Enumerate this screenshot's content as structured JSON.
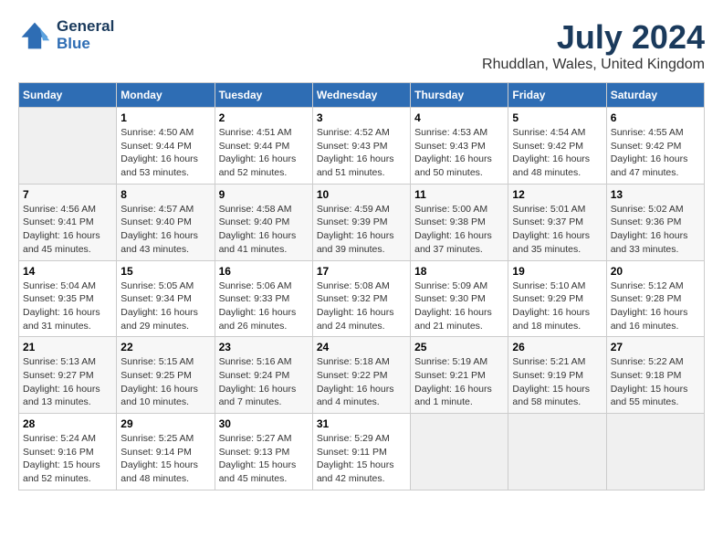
{
  "header": {
    "logo_line1": "General",
    "logo_line2": "Blue",
    "month": "July 2024",
    "location": "Rhuddlan, Wales, United Kingdom"
  },
  "days_of_week": [
    "Sunday",
    "Monday",
    "Tuesday",
    "Wednesday",
    "Thursday",
    "Friday",
    "Saturday"
  ],
  "weeks": [
    [
      {
        "num": "",
        "info": ""
      },
      {
        "num": "1",
        "info": "Sunrise: 4:50 AM\nSunset: 9:44 PM\nDaylight: 16 hours\nand 53 minutes."
      },
      {
        "num": "2",
        "info": "Sunrise: 4:51 AM\nSunset: 9:44 PM\nDaylight: 16 hours\nand 52 minutes."
      },
      {
        "num": "3",
        "info": "Sunrise: 4:52 AM\nSunset: 9:43 PM\nDaylight: 16 hours\nand 51 minutes."
      },
      {
        "num": "4",
        "info": "Sunrise: 4:53 AM\nSunset: 9:43 PM\nDaylight: 16 hours\nand 50 minutes."
      },
      {
        "num": "5",
        "info": "Sunrise: 4:54 AM\nSunset: 9:42 PM\nDaylight: 16 hours\nand 48 minutes."
      },
      {
        "num": "6",
        "info": "Sunrise: 4:55 AM\nSunset: 9:42 PM\nDaylight: 16 hours\nand 47 minutes."
      }
    ],
    [
      {
        "num": "7",
        "info": "Sunrise: 4:56 AM\nSunset: 9:41 PM\nDaylight: 16 hours\nand 45 minutes."
      },
      {
        "num": "8",
        "info": "Sunrise: 4:57 AM\nSunset: 9:40 PM\nDaylight: 16 hours\nand 43 minutes."
      },
      {
        "num": "9",
        "info": "Sunrise: 4:58 AM\nSunset: 9:40 PM\nDaylight: 16 hours\nand 41 minutes."
      },
      {
        "num": "10",
        "info": "Sunrise: 4:59 AM\nSunset: 9:39 PM\nDaylight: 16 hours\nand 39 minutes."
      },
      {
        "num": "11",
        "info": "Sunrise: 5:00 AM\nSunset: 9:38 PM\nDaylight: 16 hours\nand 37 minutes."
      },
      {
        "num": "12",
        "info": "Sunrise: 5:01 AM\nSunset: 9:37 PM\nDaylight: 16 hours\nand 35 minutes."
      },
      {
        "num": "13",
        "info": "Sunrise: 5:02 AM\nSunset: 9:36 PM\nDaylight: 16 hours\nand 33 minutes."
      }
    ],
    [
      {
        "num": "14",
        "info": "Sunrise: 5:04 AM\nSunset: 9:35 PM\nDaylight: 16 hours\nand 31 minutes."
      },
      {
        "num": "15",
        "info": "Sunrise: 5:05 AM\nSunset: 9:34 PM\nDaylight: 16 hours\nand 29 minutes."
      },
      {
        "num": "16",
        "info": "Sunrise: 5:06 AM\nSunset: 9:33 PM\nDaylight: 16 hours\nand 26 minutes."
      },
      {
        "num": "17",
        "info": "Sunrise: 5:08 AM\nSunset: 9:32 PM\nDaylight: 16 hours\nand 24 minutes."
      },
      {
        "num": "18",
        "info": "Sunrise: 5:09 AM\nSunset: 9:30 PM\nDaylight: 16 hours\nand 21 minutes."
      },
      {
        "num": "19",
        "info": "Sunrise: 5:10 AM\nSunset: 9:29 PM\nDaylight: 16 hours\nand 18 minutes."
      },
      {
        "num": "20",
        "info": "Sunrise: 5:12 AM\nSunset: 9:28 PM\nDaylight: 16 hours\nand 16 minutes."
      }
    ],
    [
      {
        "num": "21",
        "info": "Sunrise: 5:13 AM\nSunset: 9:27 PM\nDaylight: 16 hours\nand 13 minutes."
      },
      {
        "num": "22",
        "info": "Sunrise: 5:15 AM\nSunset: 9:25 PM\nDaylight: 16 hours\nand 10 minutes."
      },
      {
        "num": "23",
        "info": "Sunrise: 5:16 AM\nSunset: 9:24 PM\nDaylight: 16 hours\nand 7 minutes."
      },
      {
        "num": "24",
        "info": "Sunrise: 5:18 AM\nSunset: 9:22 PM\nDaylight: 16 hours\nand 4 minutes."
      },
      {
        "num": "25",
        "info": "Sunrise: 5:19 AM\nSunset: 9:21 PM\nDaylight: 16 hours\nand 1 minute."
      },
      {
        "num": "26",
        "info": "Sunrise: 5:21 AM\nSunset: 9:19 PM\nDaylight: 15 hours\nand 58 minutes."
      },
      {
        "num": "27",
        "info": "Sunrise: 5:22 AM\nSunset: 9:18 PM\nDaylight: 15 hours\nand 55 minutes."
      }
    ],
    [
      {
        "num": "28",
        "info": "Sunrise: 5:24 AM\nSunset: 9:16 PM\nDaylight: 15 hours\nand 52 minutes."
      },
      {
        "num": "29",
        "info": "Sunrise: 5:25 AM\nSunset: 9:14 PM\nDaylight: 15 hours\nand 48 minutes."
      },
      {
        "num": "30",
        "info": "Sunrise: 5:27 AM\nSunset: 9:13 PM\nDaylight: 15 hours\nand 45 minutes."
      },
      {
        "num": "31",
        "info": "Sunrise: 5:29 AM\nSunset: 9:11 PM\nDaylight: 15 hours\nand 42 minutes."
      },
      {
        "num": "",
        "info": ""
      },
      {
        "num": "",
        "info": ""
      },
      {
        "num": "",
        "info": ""
      }
    ]
  ]
}
